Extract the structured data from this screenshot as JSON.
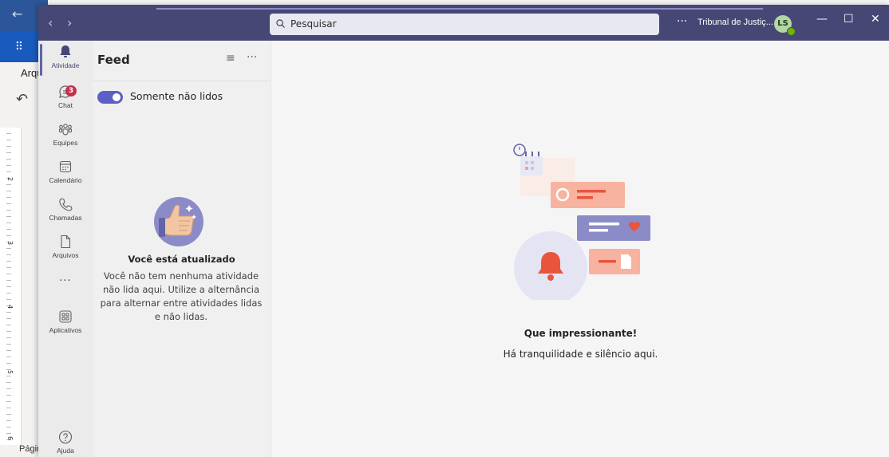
{
  "background_app": {
    "partial_tab_text": "Arqu",
    "status_text": "Págin",
    "ruler_numbers": [
      "2",
      "3",
      "4",
      "5",
      "6"
    ]
  },
  "titlebar": {
    "search_placeholder": "Pesquisar",
    "more_label": "···",
    "org_name": "Tribunal de Justiç...",
    "avatar_initials": "LS",
    "accent_color": "#464775"
  },
  "appbar": {
    "items": [
      {
        "label": "Atividade",
        "icon": "bell-icon"
      },
      {
        "label": "Chat",
        "icon": "chat-icon",
        "badge": "3"
      },
      {
        "label": "Equipes",
        "icon": "teams-icon"
      },
      {
        "label": "Calendário",
        "icon": "calendar-icon"
      },
      {
        "label": "Chamadas",
        "icon": "phone-icon"
      },
      {
        "label": "Arquivos",
        "icon": "file-icon"
      },
      {
        "label": "···",
        "icon": "more-icon"
      },
      {
        "label": "Aplicativos",
        "icon": "apps-icon"
      },
      {
        "label": "Ajuda",
        "icon": "help-icon"
      }
    ]
  },
  "feed": {
    "title": "Feed",
    "toggle_label": "Somente não lidos",
    "toggle_on": true,
    "empty_title": "Você está atualizado",
    "empty_body": "Você não tem nenhuma atividade não lida aqui. Utilize a alternância para alternar entre atividades lidas e não lidas."
  },
  "main": {
    "title": "Que impressionante!",
    "subtitle": "Há tranquilidade e silêncio aqui."
  }
}
